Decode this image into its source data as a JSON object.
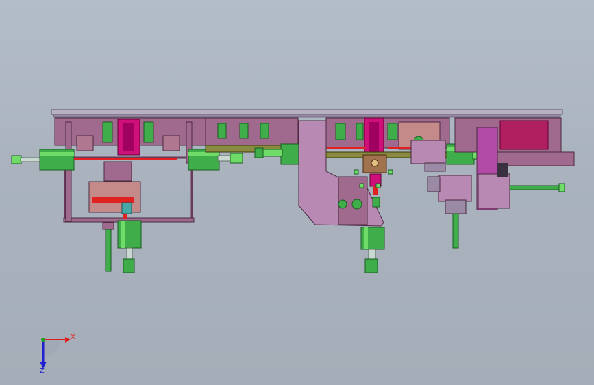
{
  "viewport": {
    "background_top": "#b3bdc7",
    "background_bottom": "#a5aeb8"
  },
  "colors": {
    "plate": "#b7b2c2",
    "frame": "#a06a8e",
    "frame_dark": "#6a3a5a",
    "magenta": "#d0107a",
    "cylinder": "#3fae4a",
    "cylinder_light": "#6fdc6a",
    "rod": "#c9d9d2",
    "red": "#e22222",
    "brown": "#a0724e",
    "salmon": "#c48a8a",
    "teal": "#48a8a8",
    "olive": "#8a8a40",
    "x_axis": "#e02020",
    "y_axis": "#20a020",
    "z_axis": "#2020d0"
  },
  "triad": {
    "x_label": "X",
    "z_label": "Z",
    "icon": "coordinate-triad-icon"
  }
}
